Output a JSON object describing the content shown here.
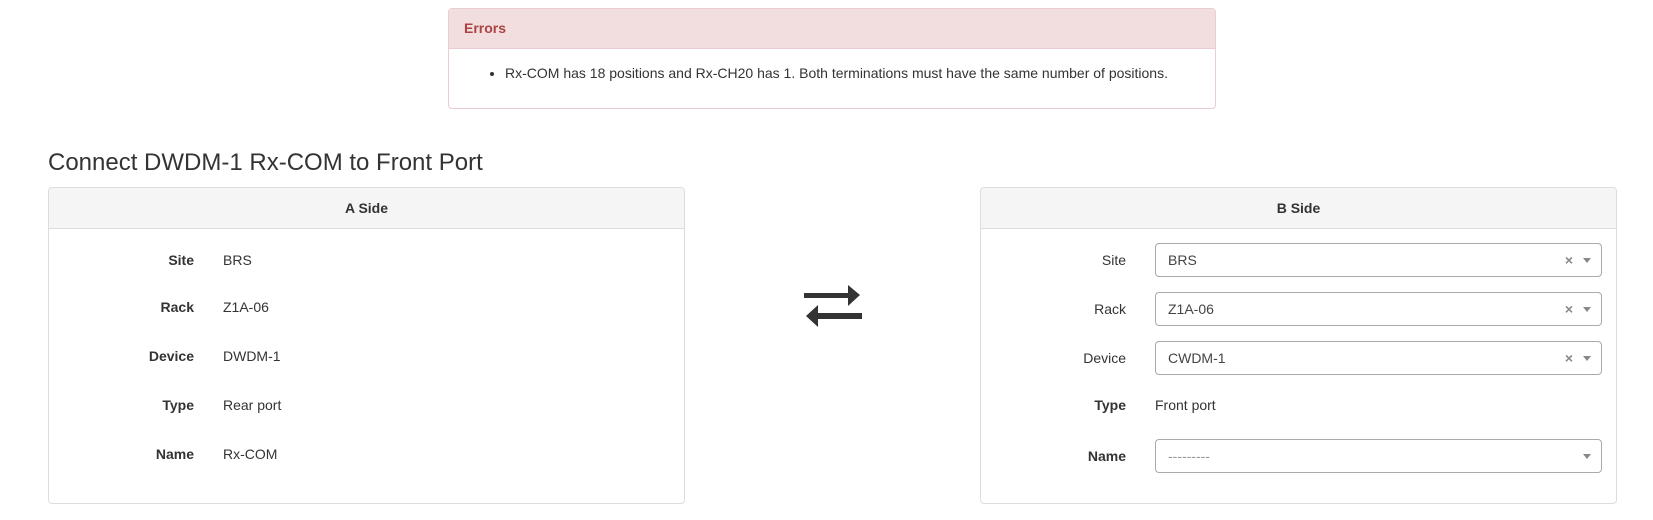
{
  "errors": {
    "title": "Errors",
    "items": [
      "Rx-COM has 18 positions and Rx-CH20 has 1. Both terminations must have the same number of positions."
    ]
  },
  "page_title": "Connect DWDM-1 Rx-COM to Front Port",
  "a_side": {
    "title": "A Side",
    "site_label": "Site",
    "site_value": "BRS",
    "rack_label": "Rack",
    "rack_value": "Z1A-06",
    "device_label": "Device",
    "device_value": "DWDM-1",
    "type_label": "Type",
    "type_value": "Rear port",
    "name_label": "Name",
    "name_value": "Rx-COM"
  },
  "b_side": {
    "title": "B Side",
    "site_label": "Site",
    "site_value": "BRS",
    "rack_label": "Rack",
    "rack_value": "Z1A-06",
    "device_label": "Device",
    "device_value": "CWDM-1",
    "type_label": "Type",
    "type_value": "Front port",
    "name_label": "Name",
    "name_value": "---------",
    "clear_glyph": "×"
  },
  "icons": {
    "swap": "exchange-arrows-icon"
  },
  "colors": {
    "error_text": "#a94442",
    "error_bg": "#f2dede",
    "panel_head_bg": "#f5f5f5"
  }
}
